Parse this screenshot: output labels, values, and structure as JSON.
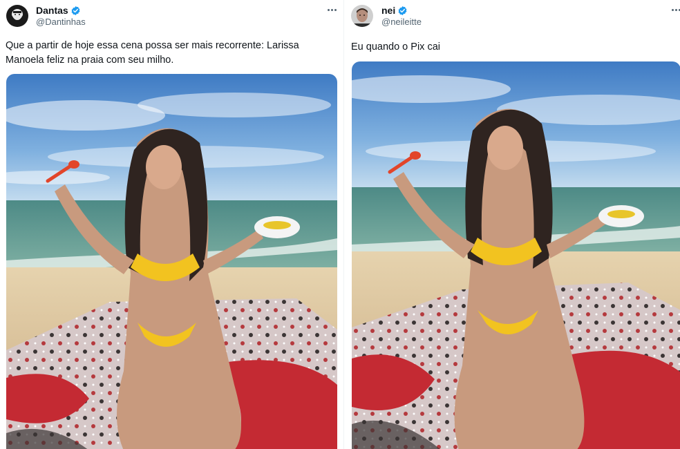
{
  "tweets": [
    {
      "display_name": "Dantas",
      "handle": "@Dantinhas",
      "verified": true,
      "text": "Que a partir de hoje essa cena possa ser mais recorrente: Larissa Manoela feliz na praia com seu milho.",
      "avatar_icon": "bearded-man-avatar",
      "media_icon": "beach-photo"
    },
    {
      "display_name": "nei",
      "handle": "@neileitte",
      "verified": true,
      "text": "Eu quando o Pix cai",
      "avatar_icon": "man-portrait-avatar",
      "media_icon": "beach-photo"
    }
  ],
  "colors": {
    "verified_blue": "#1d9bf0",
    "handle_gray": "#536471",
    "text_dark": "#0f1419"
  }
}
